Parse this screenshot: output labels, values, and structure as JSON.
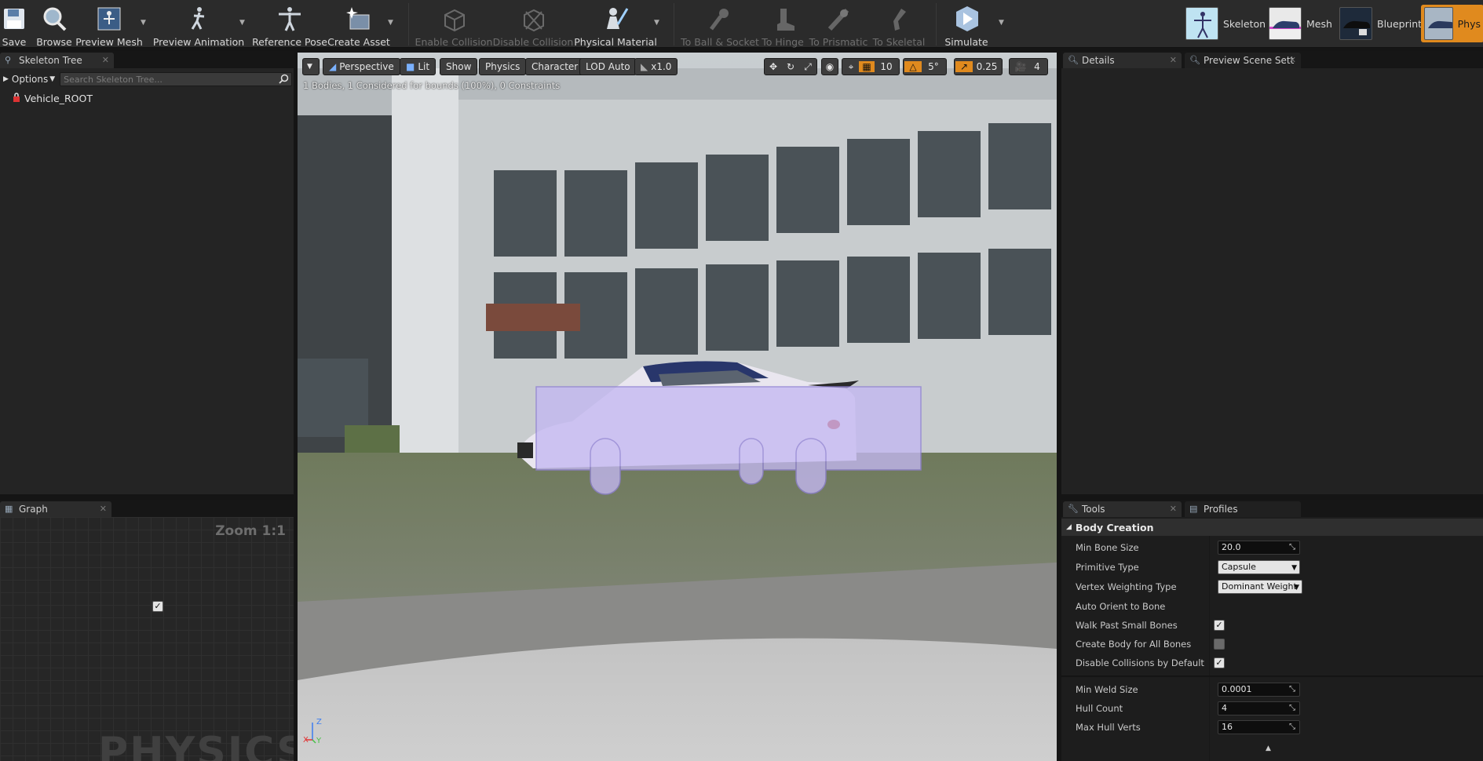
{
  "toolbar": {
    "save": "Save",
    "browse": "Browse",
    "preview_mesh": "Preview Mesh",
    "preview_animation": "Preview Animation",
    "reference_pose": "Reference Pose",
    "create_asset": "Create Asset",
    "enable_collision": "Enable Collision",
    "disable_collision": "Disable Collision",
    "physical_material": "Physical Material",
    "to_ball_socket": "To Ball & Socket",
    "to_hinge": "To Hinge",
    "to_prismatic": "To Prismatic",
    "to_skeletal": "To Skeletal",
    "simulate": "Simulate"
  },
  "modes": {
    "skeleton": "Skeleton",
    "mesh": "Mesh",
    "blueprint": "Blueprint",
    "physics": "Phys"
  },
  "skeleton_tree": {
    "tab": "Skeleton Tree",
    "options": "Options",
    "search_placeholder": "Search Skeleton Tree...",
    "root_bone": "Vehicle_ROOT"
  },
  "graph": {
    "tab": "Graph",
    "zoom": "Zoom 1:1",
    "watermark": "PHYSICS"
  },
  "viewport": {
    "perspective": "Perspective",
    "lit": "Lit",
    "show": "Show",
    "physics": "Physics",
    "character": "Character",
    "lod": "LOD Auto",
    "speed": "x1.0",
    "stats": "1 Bodies, 1 Considered for bounds (100%), 0 Constraints",
    "grid_snap": "10",
    "rot_snap": "5°",
    "scale_snap": "0.25",
    "cam_speed": "4",
    "axis_z": "Z",
    "axis_x": "X",
    "axis_y": "Y"
  },
  "details": {
    "tab": "Details",
    "preview_tab": "Preview Scene Sett"
  },
  "tools": {
    "tab": "Tools",
    "profiles_tab": "Profiles",
    "section": "Body Creation",
    "min_bone_size_label": "Min Bone Size",
    "min_bone_size": "20.0",
    "primitive_type_label": "Primitive Type",
    "primitive_type": "Capsule",
    "vertex_weighting_label": "Vertex Weighting Type",
    "vertex_weighting": "Dominant Weight",
    "auto_orient_label": "Auto Orient to Bone",
    "auto_orient": true,
    "walk_past_label": "Walk Past Small Bones",
    "walk_past": true,
    "create_all_label": "Create Body for All Bones",
    "create_all": false,
    "disable_coll_label": "Disable Collisions by Default",
    "disable_coll": true,
    "min_weld_label": "Min Weld Size",
    "min_weld": "0.0001",
    "hull_count_label": "Hull Count",
    "hull_count": "4",
    "max_hull_label": "Max Hull Verts",
    "max_hull": "16"
  },
  "colors": {
    "accent": "#e08a1e",
    "panel": "#242424",
    "body_overlay": "#c4b8f2"
  }
}
